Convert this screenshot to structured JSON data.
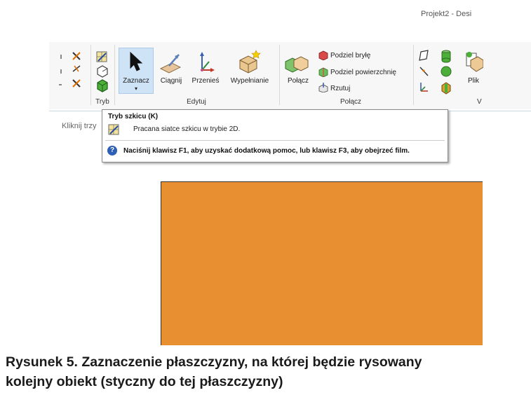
{
  "window": {
    "title": "Projekt2 - Desi"
  },
  "ribbon": {
    "groups": {
      "tryb": {
        "label": "Tryb"
      },
      "edytuj": {
        "label": "Edytuj",
        "buttons": {
          "zaznacz": "Zaznacz",
          "ciagnij": "Ciągnij",
          "przenies": "Przenieś",
          "wypelnianie": "Wypełnianie"
        }
      },
      "polacz": {
        "label": "Połącz",
        "main_button": "Połącz",
        "small_buttons": {
          "podziel_bryle": "Podziel bryłę",
          "podziel_powierzchnie": "Podziel powierzchnię",
          "rzutuj": "Rzutuj"
        }
      },
      "insert": {
        "plik_label": "Plik",
        "partial_label": "V"
      }
    },
    "zaznacz_dropdown_indicator": "▾"
  },
  "tooltip": {
    "title": "Tryb szkicu (K)",
    "description": "Pracana siatce szkicu w trybie 2D.",
    "help_text": "Naciśnij klawisz F1, aby uzyskać dodatkową pomoc, lub klawisz F3, aby obejrzeć film.",
    "help_icon_char": "?"
  },
  "hint": {
    "text": "Kliknij trzy"
  },
  "colors": {
    "canvas_plane": "#e88f32",
    "selection_highlight": "#cfe3f7",
    "help_icon": "#2d5fb6"
  },
  "caption": {
    "line1": "Rysunek 5. Zaznaczenie płaszczyzny, na której będzie rysowany",
    "line2": "kolejny obiekt (styczny do tej płaszczyzny)"
  }
}
